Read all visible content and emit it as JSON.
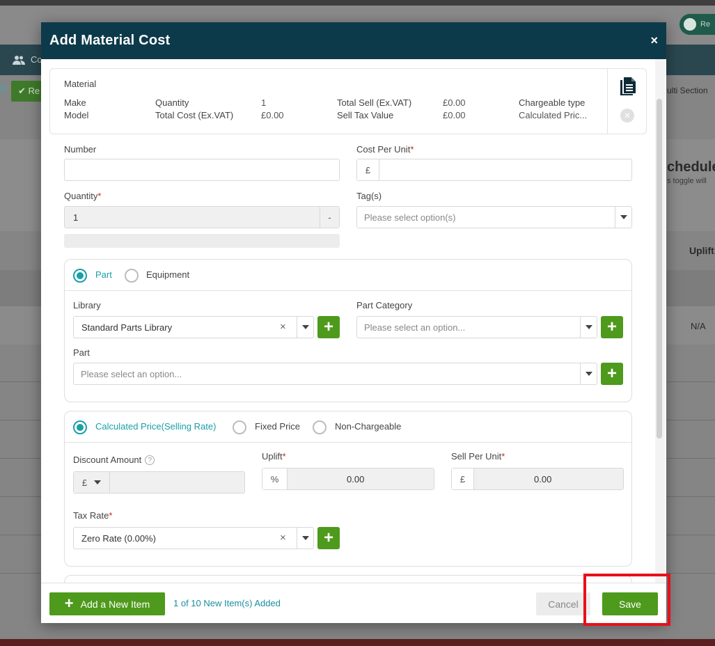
{
  "background": {
    "nav_item": "Co",
    "pill_text": "Re",
    "green_button": "Re",
    "zero": "0",
    "right_text_1": "ulti Section",
    "right_text_2": "chedule",
    "right_text_3": "s toggle will",
    "right_text_4": "Uplift",
    "right_text_5": "N/A"
  },
  "modal": {
    "title": "Add Material Cost",
    "close_symbol": "×"
  },
  "summary": {
    "title": "Material",
    "make_label": "Make",
    "model_label": "Model",
    "quantity_label": "Quantity",
    "quantity_value": "1",
    "total_cost_label": "Total Cost (Ex.VAT)",
    "total_cost_value": "£0.00",
    "total_sell_label": "Total Sell (Ex.VAT)",
    "total_sell_value": "£0.00",
    "sell_tax_label": "Sell Tax Value",
    "sell_tax_value": "£0.00",
    "chargeable_label": "Chargeable type",
    "chargeable_value": "Calculated Pric..."
  },
  "form": {
    "number_label": "Number",
    "number_value": "",
    "cost_per_unit_label": "Cost Per Unit",
    "cost_prefix": "£",
    "quantity_label": "Quantity",
    "quantity_value": "1",
    "quantity_stepper": "-",
    "tags_label": "Tag(s)",
    "tags_placeholder": "Please select option(s)",
    "required_mark": "*"
  },
  "type_card": {
    "option_part": "Part",
    "option_equipment": "Equipment",
    "selected": "Part",
    "library_label": "Library",
    "library_value": "Standard Parts Library",
    "part_category_label": "Part Category",
    "part_category_placeholder": "Please select an option...",
    "part_label": "Part",
    "part_placeholder": "Please select an option..."
  },
  "price_card": {
    "option_calculated": "Calculated Price(Selling Rate)",
    "option_fixed": "Fixed Price",
    "option_nonchargeable": "Non-Chargeable",
    "selected": "Calculated Price(Selling Rate)",
    "discount_label": "Discount Amount",
    "help_symbol": "?",
    "discount_currency": "£",
    "uplift_label": "Uplift",
    "uplift_prefix": "%",
    "uplift_value": "0.00",
    "sell_per_unit_label": "Sell Per Unit",
    "sell_prefix": "£",
    "sell_value": "0.00",
    "tax_rate_label": "Tax Rate",
    "tax_rate_value": "Zero Rate (0.00%)"
  },
  "footer": {
    "add_button_icon": "+",
    "add_button_label": "Add a New Item",
    "items_added": "1 of 10 New Item(s) Added",
    "cancel_label": "Cancel",
    "save_label": "Save"
  },
  "colors": {
    "header_bg": "#0d3a4a",
    "accent_green": "#4e9a1c",
    "accent_teal": "#18a0a8",
    "highlight_red": "#e8101c"
  }
}
